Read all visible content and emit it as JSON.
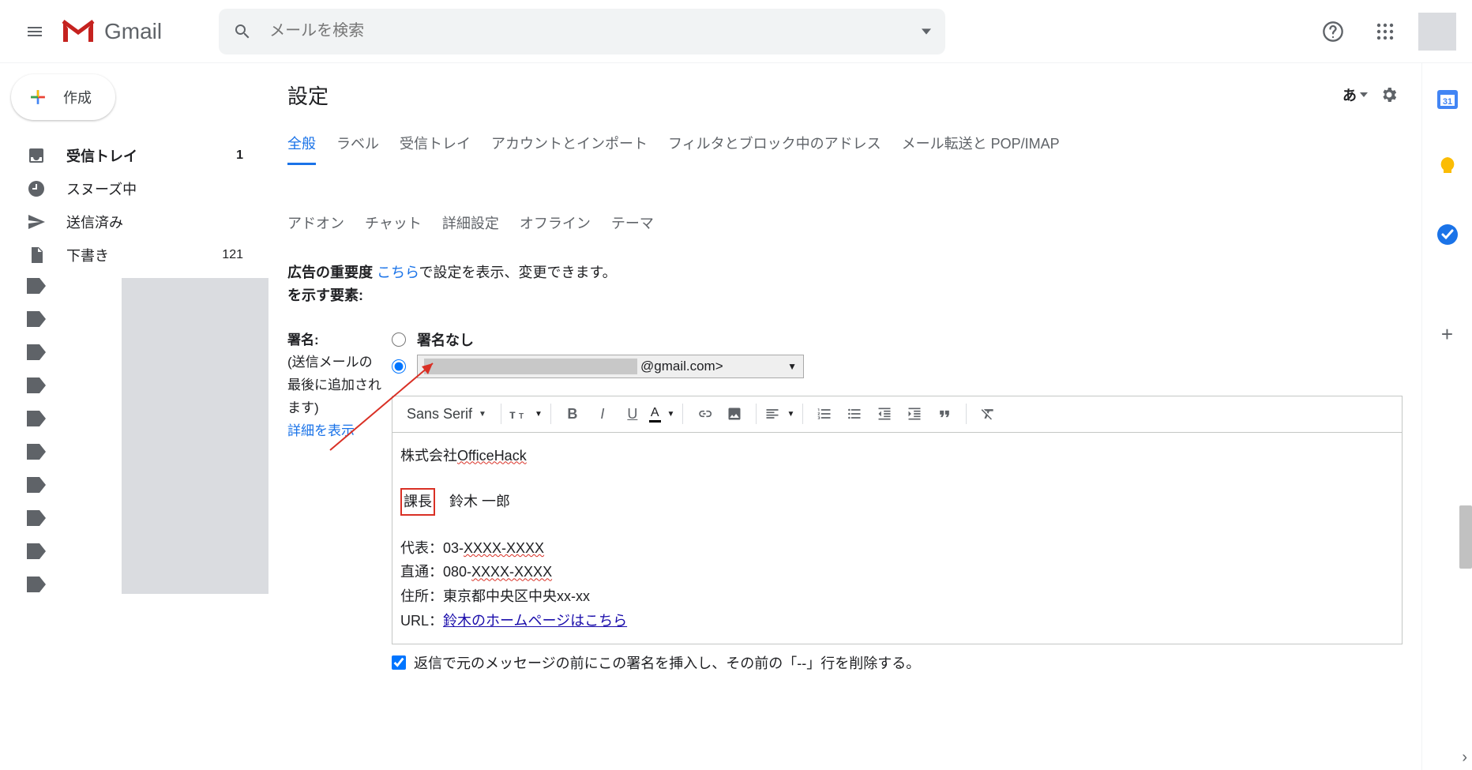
{
  "header": {
    "product_name": "Gmail",
    "search_placeholder": "メールを検索"
  },
  "sidebar": {
    "compose_label": "作成",
    "items": [
      {
        "label": "受信トレイ",
        "count": "1",
        "bold": true
      },
      {
        "label": "スヌーズ中",
        "count": "",
        "bold": false
      },
      {
        "label": "送信済み",
        "count": "",
        "bold": false
      },
      {
        "label": "下書き",
        "count": "121",
        "bold": false
      }
    ]
  },
  "main": {
    "title": "設定",
    "lang_indicator": "あ",
    "tabs_row1": [
      "全般",
      "ラベル",
      "受信トレイ",
      "アカウントとインポート",
      "フィルタとブロック中のアドレス",
      "メール転送と POP/IMAP"
    ],
    "tabs_row2": [
      "アドオン",
      "チャット",
      "詳細設定",
      "オフライン",
      "テーマ"
    ],
    "ad_label": "広告の重要度を示す要素:",
    "ad_text_pre": "広告の重要度",
    "ad_link": "こちら",
    "ad_text_post": "で設定を表示、変更できます。",
    "ad_label_line2": "を示す要素:",
    "signature": {
      "label": "署名:",
      "note1": "(送信メールの",
      "note2": "最後に追加され",
      "note3": "ます)",
      "detail_link": "詳細を表示",
      "radio_none": "署名なし",
      "account_suffix": "@gmail.com>",
      "toolbar_font": "Sans Serif",
      "body": {
        "company_pre": "株式会社",
        "company_wavy": "OfficeHack",
        "title_boxed": "課長",
        "name": "鈴木 一郎",
        "tel1_pre": "代表：03-",
        "tel1_wavy": "XXXX-XXXX",
        "tel2_pre": "直通：080-",
        "tel2_wavy": "XXXX-XXXX",
        "addr": "住所：東京都中央区中央xx-xx",
        "url_pre": "URL：",
        "url_link": "鈴木のホームページはこちら"
      },
      "reply_checkbox": "返信で元のメッセージの前にこの署名を挿入し、その前の「--」行を削除する。"
    }
  }
}
